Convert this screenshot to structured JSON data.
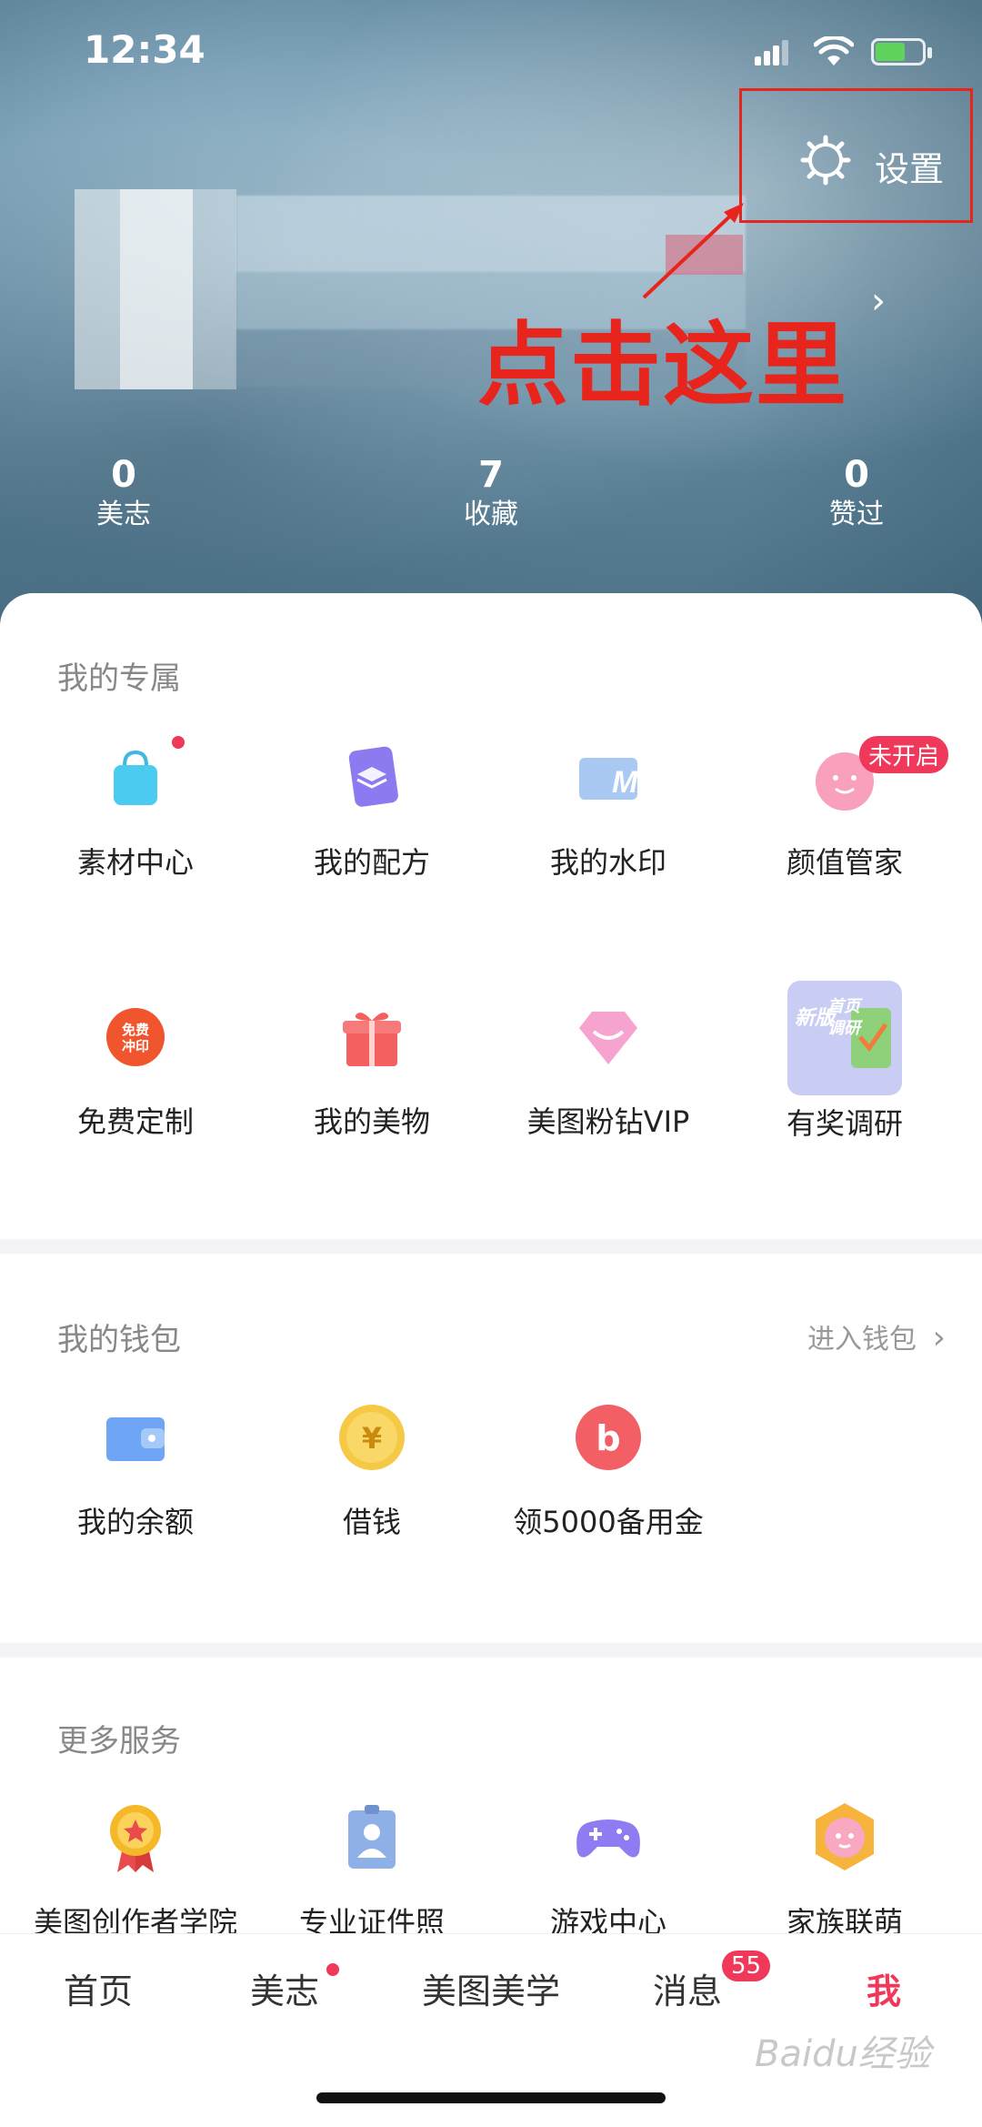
{
  "status_bar": {
    "time": "12:34"
  },
  "header": {
    "settings_label": "设置",
    "annotation": "点击这里",
    "stats": [
      {
        "value": "0",
        "label": "美志"
      },
      {
        "value": "7",
        "label": "收藏"
      },
      {
        "value": "0",
        "label": "赞过"
      }
    ]
  },
  "exclusive": {
    "title": "我的专属",
    "items": [
      {
        "label": "素材中心",
        "icon": "shopping-bag-icon"
      },
      {
        "label": "我的配方",
        "icon": "layers-card-icon"
      },
      {
        "label": "我的水印",
        "icon": "watermark-icon"
      },
      {
        "label": "颜值管家",
        "icon": "smiley-face-icon",
        "badge": "未开启"
      },
      {
        "label": "免费定制",
        "icon": "free-print-icon",
        "icon_text": "免费冲印"
      },
      {
        "label": "我的美物",
        "icon": "gift-box-icon"
      },
      {
        "label": "美图粉钻VIP",
        "icon": "pink-diamond-icon"
      },
      {
        "label": "有奖调研",
        "icon": "survey-banner-icon",
        "icon_text": "新版首页调研"
      }
    ]
  },
  "wallet": {
    "title": "我的钱包",
    "link": "进入钱包",
    "items": [
      {
        "label": "我的余额",
        "icon": "wallet-icon"
      },
      {
        "label": "借钱",
        "icon": "yuan-coin-icon",
        "icon_text": "¥"
      },
      {
        "label": "领5000备用金",
        "icon": "b-circle-icon",
        "icon_text": "b"
      }
    ]
  },
  "more": {
    "title": "更多服务",
    "items": [
      {
        "label": "美图创作者学院",
        "icon": "medal-icon"
      },
      {
        "label": "专业证件照",
        "icon": "id-photo-icon"
      },
      {
        "label": "游戏中心",
        "icon": "gamepad-icon"
      },
      {
        "label": "家族联萌",
        "icon": "family-badge-icon"
      }
    ]
  },
  "tabs": [
    {
      "label": "首页"
    },
    {
      "label": "美志"
    },
    {
      "label": "美图美学"
    },
    {
      "label": "消息",
      "badge": "55"
    },
    {
      "label": "我"
    }
  ],
  "watermark": "Baidu经验",
  "colors": {
    "accent": "#f0385a",
    "annotation": "#e8251d"
  }
}
